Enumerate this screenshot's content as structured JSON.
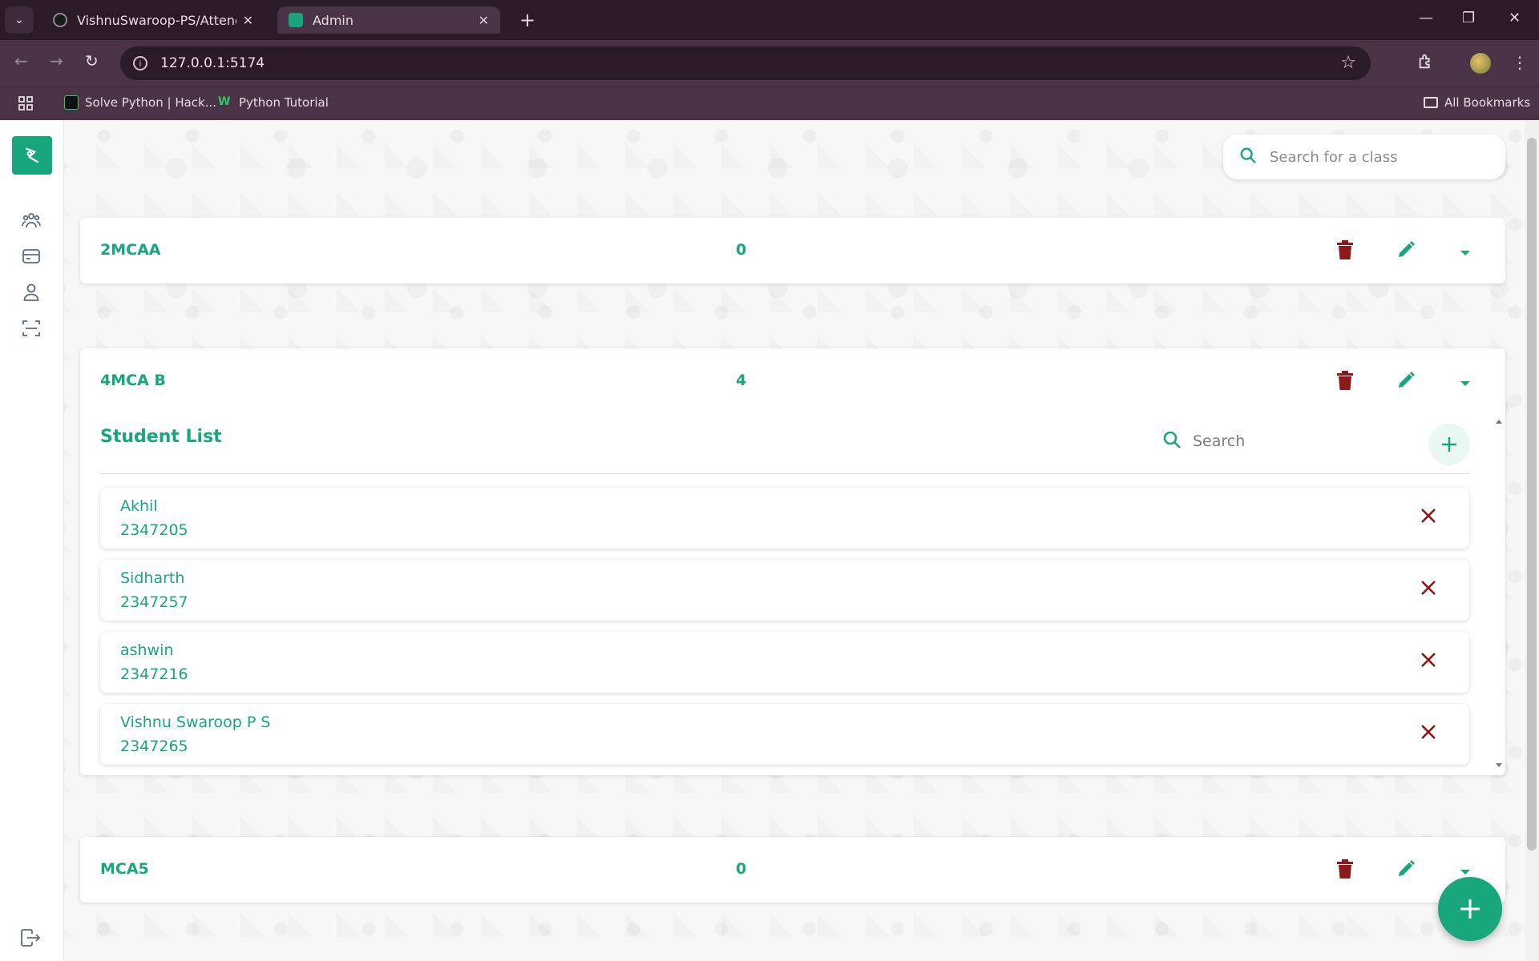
{
  "browser": {
    "tabs": [
      {
        "title": "VishnuSwaroop-PS/Attendify",
        "close": "✕"
      },
      {
        "title": "Admin",
        "close": "✕"
      }
    ],
    "new_tab": "+",
    "url": "127.0.0.1:5174",
    "bookmarks": [
      {
        "label": "Solve Python | Hack..."
      },
      {
        "label": "Python Tutorial"
      }
    ],
    "all_bookmarks": "All Bookmarks"
  },
  "app": {
    "search_placeholder": "Search for a class",
    "classes": [
      {
        "name": "2MCAA",
        "count": "0"
      },
      {
        "name": "4MCA B",
        "count": "4"
      },
      {
        "name": "MCA5",
        "count": "0"
      }
    ],
    "student_list": {
      "title": "Student List",
      "search_placeholder": "Search",
      "students": [
        {
          "name": "Akhil",
          "id": "2347205"
        },
        {
          "name": "Sidharth",
          "id": "2347257"
        },
        {
          "name": "ashwin",
          "id": "2347216"
        },
        {
          "name": "Vishnu Swaroop P S",
          "id": "2347265"
        }
      ]
    },
    "colors": {
      "accent": "#18a67d",
      "danger": "#8b1a1a"
    }
  }
}
